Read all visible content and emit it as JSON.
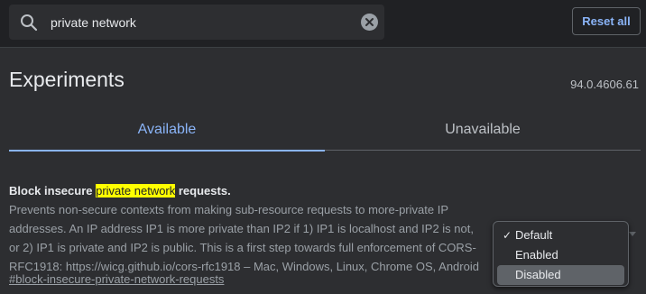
{
  "header": {
    "search": {
      "value": "private network",
      "icon": "search-icon",
      "clear_icon": "clear-icon"
    },
    "reset_label": "Reset all"
  },
  "main": {
    "title": "Experiments",
    "version": "94.0.4606.61",
    "tabs": [
      {
        "label": "Available",
        "active": true
      },
      {
        "label": "Unavailable",
        "active": false
      }
    ],
    "experiment": {
      "title_prefix": "Block insecure ",
      "title_highlight": "private network",
      "title_suffix": " requests.",
      "description": "Prevents non-secure contexts from making sub-resource requests to more-private IP addresses. An IP address IP1 is more private than IP2 if 1) IP1 is localhost and IP2 is not, or 2) IP1 is private and IP2 is public. This is a first step towards full enforcement of CORS-RFC1918: https://wicg.github.io/cors-rfc1918 – Mac, Windows, Linux, Chrome OS, Android",
      "link": "#block-insecure-private-network-requests",
      "dropdown": {
        "checked_option": "Default",
        "hovered_option": "Disabled",
        "options": [
          "Default",
          "Enabled",
          "Disabled"
        ]
      }
    }
  },
  "colors": {
    "accent": "#8ab4f8",
    "highlight": "#ffff00",
    "background": "#2d2e31",
    "header_background": "#202124"
  }
}
